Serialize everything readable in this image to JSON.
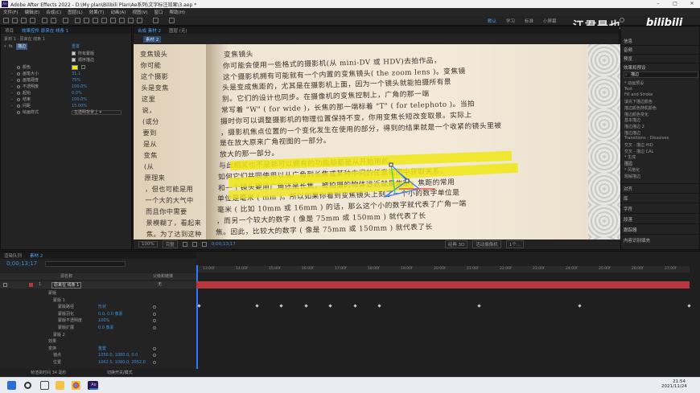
{
  "titlebar": {
    "app_title": "Adobe After Effects 2022 - D:\\My plan\\Bilibili Plan\\Ae系列\\文字标注效果\\3.aep *"
  },
  "menu": [
    "文件(F)",
    "编辑(E)",
    "合成(C)",
    "图层(L)",
    "效果(T)",
    "动画(A)",
    "视图(V)",
    "窗口",
    "帮助(H)"
  ],
  "workspace": {
    "items": [
      "默认",
      "学习",
      "标准",
      "小屏幕"
    ],
    "active": "默认",
    "search_placeholder": "搜索帮助"
  },
  "watermark": {
    "name": "江君是也",
    "brand": "bilibili"
  },
  "left_panel": {
    "tabs": [
      "项目",
      "效果控件 原来在 线条 1"
    ],
    "layer_line": "素材 1 · 原来在 线条 1",
    "effect_name": "描边",
    "effect_reset": "重置",
    "checkbox1": "所有蒙版",
    "checkbox2": "顺序描边",
    "params": [
      {
        "label": "颜色",
        "value": ""
      },
      {
        "label": "画笔大小",
        "value": "31.1"
      },
      {
        "label": "画笔硬度",
        "value": "75%"
      },
      {
        "label": "不透明度",
        "value": "100.0%"
      },
      {
        "label": "起始",
        "value": "0.0%"
      },
      {
        "label": "结束",
        "value": "100.0%"
      },
      {
        "label": "间距",
        "value": "15.00%"
      },
      {
        "label": "绘画样式",
        "value": "在透明背景上"
      }
    ],
    "color_swatch": "#f5e50c"
  },
  "viewer": {
    "tabs": [
      "合成 素材 2",
      "图层 (无)"
    ],
    "comp_tab": "素材 2",
    "zoom": "100%",
    "quality": "完整",
    "timecode": "0;00;13;17",
    "renderer": "经典 3D",
    "camera": "活动摄像机",
    "views": "1个...",
    "book_lines_left": [
      "变焦镜头",
      "你可能",
      "这个摄影",
      "头是变焦",
      "这里",
      "说，",
      "(或分",
      "要到",
      "是从",
      "变焦",
      "(从",
      "原理来",
      "，但也可能是用",
      "一个大的大气中",
      "而且你中需要",
      "景模糊了，看起来",
      "焦。为了达到这种"
    ],
    "book_lines_right": [
      "变焦镜头",
      "你可能会使用一些格式的摄影机(从 mini-DV 或 HDV)去拍作品，",
      "这个摄影机拥有可能就有一个内置的变焦镜头( the zoom lens )。变焦镜",
      "头是变成焦距的，尤其是在摄影机上面，因为一个镜头就能拍摄所有景",
      "别。它们的设计也同步。在摄像机的变焦控制上，广角的那一端",
      "常写着 \"W\" ( for wide )，长焦的那一端标着 \"T\" ( for telephoto )。当拍",
      "摄时你可以调整摄影机的物理位置保持不变，你用变焦长短改变取景。实际上",
      "，摄影机焦点位置的一个变化发生在使用的部分，得到的结果就是一个收紧的镜头里被",
      "是在放大原来广角视图的一部分。",
      "放大的那一部分。",
      "与此相关也不是都可以拥有的功能却都是从开始用的，",
      "如何它们共同使用以从广角到长焦或某种中间的任意视图中获取关系，",
      "和一个镜头要用广角还是长焦，被拍摄的物体远近就是焦距，焦距的常用",
      "单位是毫米 ( mm )。所以如果你看到变焦镜头上刻了一个小的数字单位是",
      "毫米 ( 比如 10mm 或 16mm ) 的话，那么这个小的数字就代表了广角一端",
      "，而另一个较大的数字 ( 像是 75mm 或 150mm ) 就代表了长",
      "焦。因此，比较大的数字 ( 像是 75mm 或 150mm ) 就代表了长"
    ]
  },
  "right_panel": {
    "sections": [
      "信息",
      "音频",
      "预览"
    ],
    "effects_title": "效果和预设",
    "search_value": "描边",
    "tree": [
      "* 动画预设",
      "  Text",
      "    Fill and Stroke",
      "      填充下描边颜色",
      "      描边颜色随机颜色",
      "      描边颜色变化",
      "      基本描边",
      "      描边描边 2",
      "      描边描边",
      "  Transitions - Dissolves",
      "    交叉 - 描边 HiD",
      "    交叉 - 描边 CAL",
      "* 生成",
      "    描边",
      "* 风格化",
      "    题解描边"
    ],
    "bottom_sections": [
      "对齐",
      "库",
      "字符",
      "段落",
      "跟踪器",
      "内容识别填充"
    ]
  },
  "timeline": {
    "tabs": [
      "渲染队列",
      "素材 2"
    ],
    "timecode": "0;00;13;17",
    "col_headers": [
      "源名称",
      "父级和链接"
    ],
    "layer_name": "原来在 线条 1",
    "layer_num": "1",
    "parent": "无",
    "rows": [
      {
        "name": "蒙版",
        "value": ""
      },
      {
        "name": "蒙版 1",
        "value": ""
      },
      {
        "name": "蒙版路径",
        "value": "形状"
      },
      {
        "name": "蒙版羽化",
        "value": "0.0, 0.0 像素"
      },
      {
        "name": "蒙版不透明度",
        "value": "100%"
      },
      {
        "name": "蒙版扩展",
        "value": "0.0 像素"
      },
      {
        "name": "蒙版 2",
        "value": ""
      },
      {
        "name": "效果",
        "value": ""
      },
      {
        "name": "变换",
        "value": "重置"
      },
      {
        "name": "锚点",
        "value": "1050.0, 1080.0, 0.0"
      },
      {
        "name": "位置",
        "value": "1062.5, 1080.0, 2052.0"
      }
    ],
    "ruler_ticks": [
      "13:00f",
      "14:00f",
      "15:00f",
      "16:00f",
      "17:00f",
      "18:00f",
      "19:00f",
      "20:00f",
      "21:00f",
      "22:00f",
      "23:00f",
      "24:00f",
      "25:00f",
      "26:00f",
      "27:00f"
    ],
    "footer_render": "帧渲染时间 34 毫秒",
    "footer_toggle": "切换开关/模式"
  },
  "taskbar": {
    "time": "21:54",
    "date": "2021/11/24"
  }
}
